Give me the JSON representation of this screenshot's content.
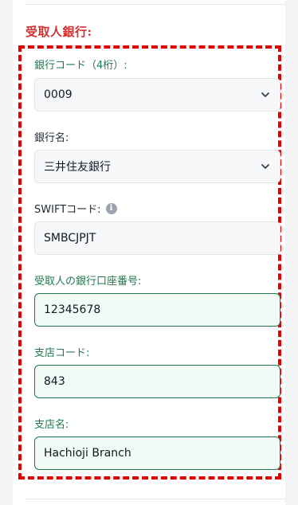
{
  "section": {
    "title": "受取人銀行:"
  },
  "fields": {
    "bank_code": {
      "label": "銀行コード（4桁）:",
      "value": "0009"
    },
    "bank_name": {
      "label": "銀行名:",
      "value": "三井住友銀行"
    },
    "swift": {
      "label": "SWIFTコード:",
      "info_icon": "i",
      "value": "SMBCJPJT"
    },
    "account_number": {
      "label": "受取人の銀行口座番号:",
      "value": "12345678"
    },
    "branch_code": {
      "label": "支店コード:",
      "value": "843"
    },
    "branch_name": {
      "label": "支店名:",
      "value": "Hachioji Branch"
    }
  },
  "colors": {
    "accent_red": "#d32f2f",
    "highlight_border": "#e00000",
    "green": "#1f7a4f"
  },
  "icons": {
    "select_arrow": "chevron-down-icon",
    "info": "info-icon"
  }
}
